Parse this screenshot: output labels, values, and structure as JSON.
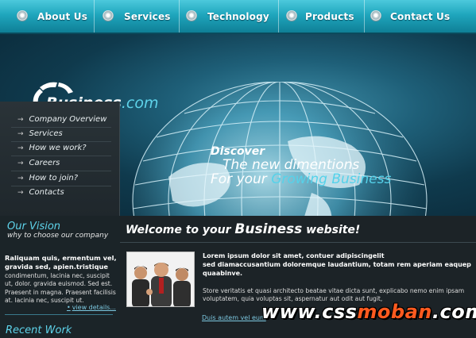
{
  "nav": {
    "items": [
      {
        "label": "About Us"
      },
      {
        "label": "Services"
      },
      {
        "label": "Technology"
      },
      {
        "label": "Products"
      },
      {
        "label": "Contact Us"
      }
    ]
  },
  "banner": {
    "logo_name": "Business",
    "logo_suffix": ".com",
    "slogan_1": "Discover",
    "slogan_2": "The new dimentions",
    "slogan_3_prefix": "For your ",
    "slogan_3_highlight": "Growing Business"
  },
  "menu": {
    "items": [
      {
        "label": "Company Overview"
      },
      {
        "label": "Services"
      },
      {
        "label": "How we work?"
      },
      {
        "label": "Careers"
      },
      {
        "label": "How to join?"
      },
      {
        "label": "Contacts"
      }
    ]
  },
  "sidebar": {
    "vision_title": "Our Vision",
    "vision_subtitle": "why to choose our company",
    "lead_line1": "Raliquam quis, ermentum vel,",
    "lead_line2": "gravida sed, apien.tristique",
    "body": "condimentum, lacinia nec, suscipit ut, dolor. gravida euismod. Sed est. Praesent in magna. Praesent facilisis at. lacinia nec, suscipit ut.",
    "view_details": "view details...",
    "recent_title": "Recent Work"
  },
  "main": {
    "welcome_prefix": "Welcome to your ",
    "welcome_big": "Business",
    "welcome_suffix": " website!",
    "intro_line1": "Lorem ipsum dolor sit amet, contuer adipiscingelit",
    "intro_line2": "sed diamaccusantium doloremque laudantium, totam rem aperiam eaquep quaabinve.",
    "paragraph": "Store veritatis et quasi architecto beatae vitae dicta sunt, explicabo nemo enim ipsam voluptatem, quia voluptas sit, aspernatur aut odit aut fugit,",
    "link": "Duis autem vel eum"
  },
  "watermark": {
    "prefix": "www.css",
    "middle": "moban",
    "suffix": ".com"
  },
  "colors": {
    "nav_top": "#4cc9dc",
    "nav_bottom": "#0f7f96",
    "accent": "#5ed3ea",
    "background": "#1c2327",
    "watermark_accent": "#ff5a1f"
  }
}
